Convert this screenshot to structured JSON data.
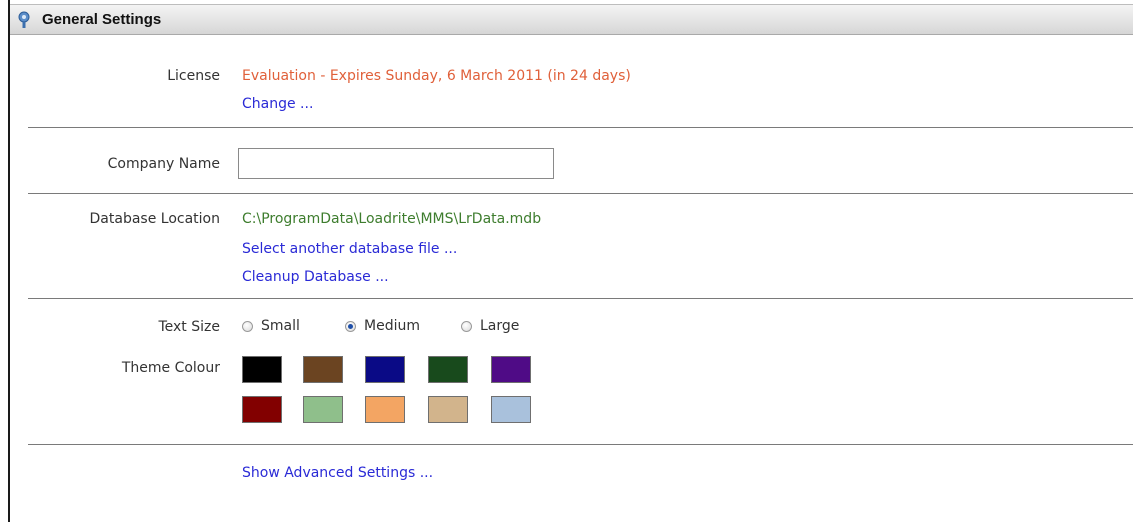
{
  "header": {
    "title": "General Settings",
    "icon": "settings-gear-icon"
  },
  "license": {
    "label": "License",
    "value": "Evaluation - Expires Sunday, 6 March 2011 (in 24 days)",
    "change_link": "Change ...",
    "value_color": "#e0603a"
  },
  "company": {
    "label": "Company Name",
    "value": "",
    "placeholder": ""
  },
  "database": {
    "label": "Database Location",
    "path": "C:\\ProgramData\\Loadrite\\MMS\\LrData.mdb",
    "select_link": "Select another database file ...",
    "cleanup_link": "Cleanup Database ...",
    "path_color": "#3e7d2e"
  },
  "text_size": {
    "label": "Text Size",
    "options": [
      {
        "label": "Small",
        "checked": false
      },
      {
        "label": "Medium",
        "checked": true
      },
      {
        "label": "Large",
        "checked": false
      }
    ]
  },
  "theme": {
    "label": "Theme Colour",
    "colors": [
      "#000000",
      "#6b4421",
      "#0a0a86",
      "#184a1c",
      "#4f0b86",
      "#820000",
      "#8fbf8b",
      "#f3a563",
      "#d2b48c",
      "#a9c1dc"
    ]
  },
  "advanced": {
    "link": "Show Advanced Settings ..."
  },
  "link_color": "#2a2ad6"
}
